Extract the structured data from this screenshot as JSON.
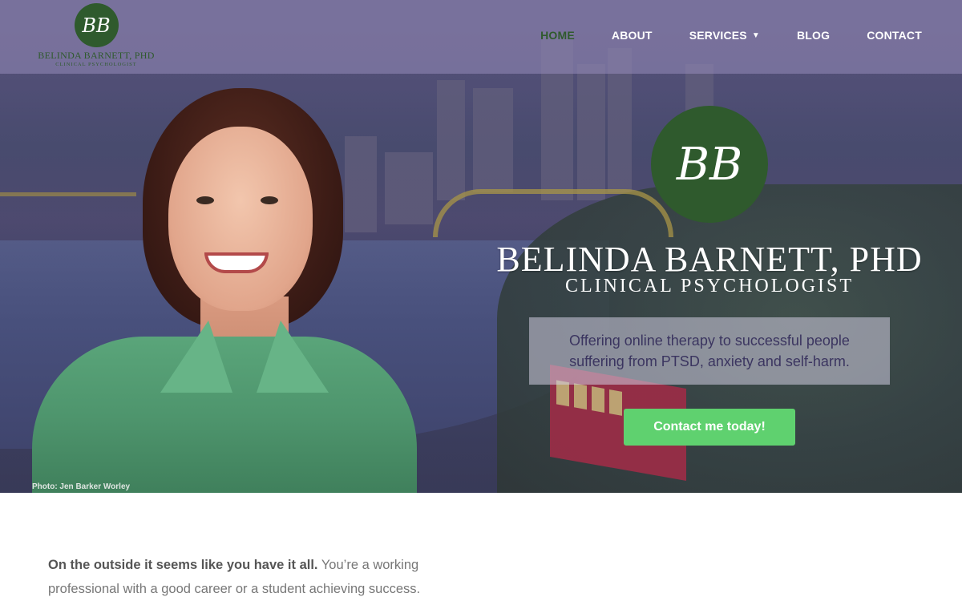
{
  "header": {
    "logo": {
      "monogram": "BB",
      "name": "BELINDA BARNETT, PHD",
      "subtitle": "CLINICAL PSYCHOLOGIST"
    },
    "nav": [
      {
        "label": "HOME",
        "active": true
      },
      {
        "label": "ABOUT",
        "active": false
      },
      {
        "label": "SERVICES",
        "active": false,
        "has_dropdown": true
      },
      {
        "label": "BLOG",
        "active": false
      },
      {
        "label": "CONTACT",
        "active": false
      }
    ]
  },
  "hero": {
    "monogram": "BB",
    "title": "BELINDA BARNETT, PHD",
    "subtitle": "CLINICAL PSYCHOLOGIST",
    "tagline": "Offering online therapy to successful people suffering from PTSD, anxiety and self-harm.",
    "cta_label": "Contact me today!",
    "photo_credit": "Photo: Jen Barker Worley"
  },
  "intro": {
    "lead_bold": "On the outside it seems like you have it all.",
    "lead_rest": " You’re a working professional with a good career or a student achieving success."
  },
  "colors": {
    "brand_green": "#2f5a2d",
    "cta_green": "#5fd16f",
    "header_overlay": "#968cb9"
  }
}
